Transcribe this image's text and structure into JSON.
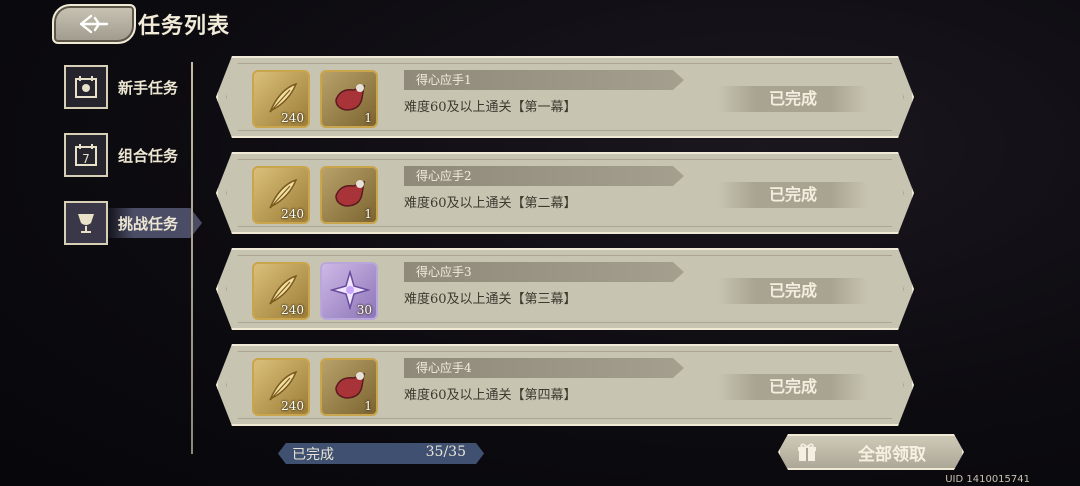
{
  "header": {
    "title": "任务列表"
  },
  "sidebar": {
    "items": [
      {
        "label": "新手任务",
        "icon": "calendar-sun-icon",
        "active": false
      },
      {
        "label": "组合任务",
        "icon": "calendar-7-icon",
        "active": false
      },
      {
        "label": "挑战任务",
        "icon": "trophy-cup-icon",
        "active": true
      }
    ]
  },
  "tasks": [
    {
      "name": "得心应手1",
      "desc": "难度60及以上通关【第一幕】",
      "status": "已完成",
      "rewards": [
        {
          "icon": "gold-feather-icon",
          "count": "240"
        },
        {
          "icon": "red-chest-icon",
          "count": "1"
        }
      ]
    },
    {
      "name": "得心应手2",
      "desc": "难度60及以上通关【第二幕】",
      "status": "已完成",
      "rewards": [
        {
          "icon": "gold-feather-icon",
          "count": "240"
        },
        {
          "icon": "red-chest-icon",
          "count": "1"
        }
      ]
    },
    {
      "name": "得心应手3",
      "desc": "难度60及以上通关【第三幕】",
      "status": "已完成",
      "rewards": [
        {
          "icon": "gold-feather-icon",
          "count": "240"
        },
        {
          "icon": "purple-star-crystal-icon",
          "count": "30"
        }
      ]
    },
    {
      "name": "得心应手4",
      "desc": "难度60及以上通关【第四幕】",
      "status": "已完成",
      "rewards": [
        {
          "icon": "gold-feather-icon",
          "count": "240"
        },
        {
          "icon": "red-chest-icon",
          "count": "1"
        }
      ]
    }
  ],
  "footer": {
    "progress_label": "已完成",
    "progress_count": "35/35",
    "progress_fraction": 1.0,
    "claim_all_label": "全部领取",
    "uid": "UID 1410015741"
  }
}
